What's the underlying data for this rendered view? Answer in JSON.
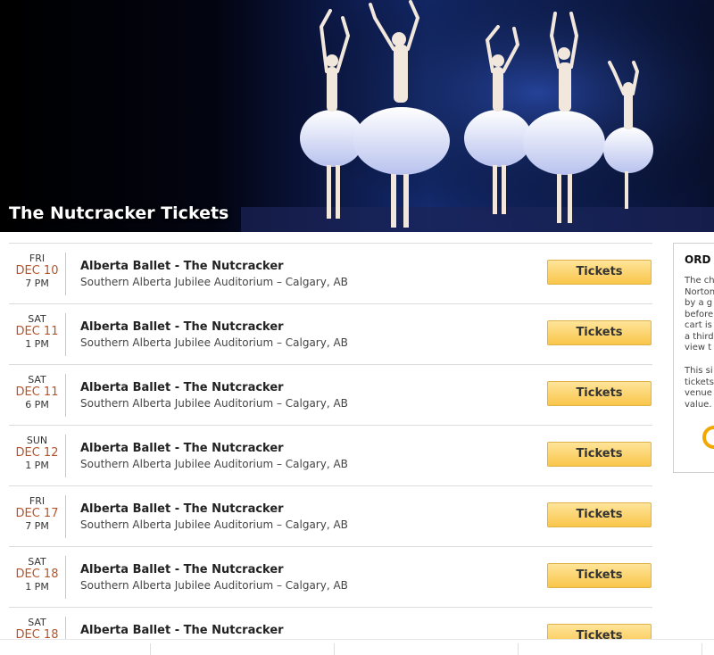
{
  "hero": {
    "title": "The Nutcracker Tickets"
  },
  "events": [
    {
      "dow": "FRI",
      "date": "DEC 10",
      "time": "7 PM",
      "name": "Alberta Ballet - The Nutcracker",
      "venue": "Southern Alberta Jubilee Auditorium – Calgary, AB",
      "button": "Tickets"
    },
    {
      "dow": "SAT",
      "date": "DEC 11",
      "time": "1 PM",
      "name": "Alberta Ballet - The Nutcracker",
      "venue": "Southern Alberta Jubilee Auditorium – Calgary, AB",
      "button": "Tickets"
    },
    {
      "dow": "SAT",
      "date": "DEC 11",
      "time": "6 PM",
      "name": "Alberta Ballet - The Nutcracker",
      "venue": "Southern Alberta Jubilee Auditorium – Calgary, AB",
      "button": "Tickets"
    },
    {
      "dow": "SUN",
      "date": "DEC 12",
      "time": "1 PM",
      "name": "Alberta Ballet - The Nutcracker",
      "venue": "Southern Alberta Jubilee Auditorium – Calgary, AB",
      "button": "Tickets"
    },
    {
      "dow": "FRI",
      "date": "DEC 17",
      "time": "7 PM",
      "name": "Alberta Ballet - The Nutcracker",
      "venue": "Southern Alberta Jubilee Auditorium – Calgary, AB",
      "button": "Tickets"
    },
    {
      "dow": "SAT",
      "date": "DEC 18",
      "time": "1 PM",
      "name": "Alberta Ballet - The Nutcracker",
      "venue": "Southern Alberta Jubilee Auditorium – Calgary, AB",
      "button": "Tickets"
    },
    {
      "dow": "SAT",
      "date": "DEC 18",
      "time": "",
      "name": "Alberta Ballet - The Nutcracker",
      "venue": "",
      "button": "Tickets"
    }
  ],
  "side_panel": {
    "title": "ORD",
    "para1": [
      "The ch",
      "Norton",
      "by a g",
      "before",
      "cart is",
      "a third",
      "view t"
    ],
    "para2": [
      "This si",
      "tickets",
      "venue",
      "value."
    ],
    "icon": "norton-badge-icon"
  },
  "colors": {
    "date_accent": "#b5542a",
    "button_gold": "#f9c64a"
  }
}
